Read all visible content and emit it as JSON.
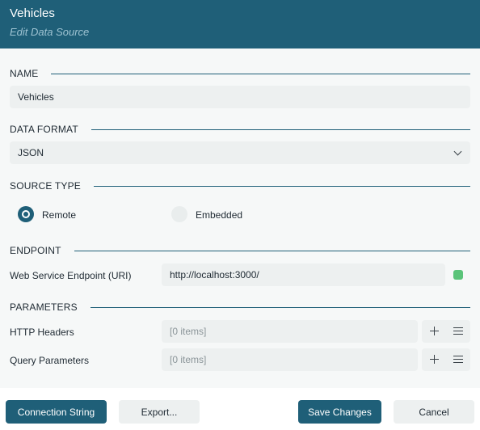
{
  "header": {
    "title": "Vehicles",
    "subtitle": "Edit Data Source"
  },
  "sections": {
    "name": "NAME",
    "data_format": "DATA FORMAT",
    "source_type": "SOURCE TYPE",
    "endpoint": "ENDPOINT",
    "parameters": "PARAMETERS"
  },
  "name_field": {
    "value": "Vehicles"
  },
  "data_format": {
    "selected": "JSON"
  },
  "source_type": {
    "options": [
      {
        "label": "Remote",
        "selected": true
      },
      {
        "label": "Embedded",
        "selected": false
      }
    ]
  },
  "endpoint": {
    "label": "Web Service Endpoint (URI)",
    "value": "http://localhost:3000/",
    "status_color": "#5bc47a"
  },
  "parameters": {
    "http_headers": {
      "label": "HTTP Headers",
      "value": "[0 items]"
    },
    "query_parameters": {
      "label": "Query Parameters",
      "value": "[0 items]"
    }
  },
  "footer": {
    "connection_string": "Connection String",
    "export": "Export...",
    "save_changes": "Save Changes",
    "cancel": "Cancel"
  },
  "colors": {
    "accent": "#1f5f78",
    "panel_bg": "#f6f8f8",
    "field_bg": "#edf0f0"
  }
}
